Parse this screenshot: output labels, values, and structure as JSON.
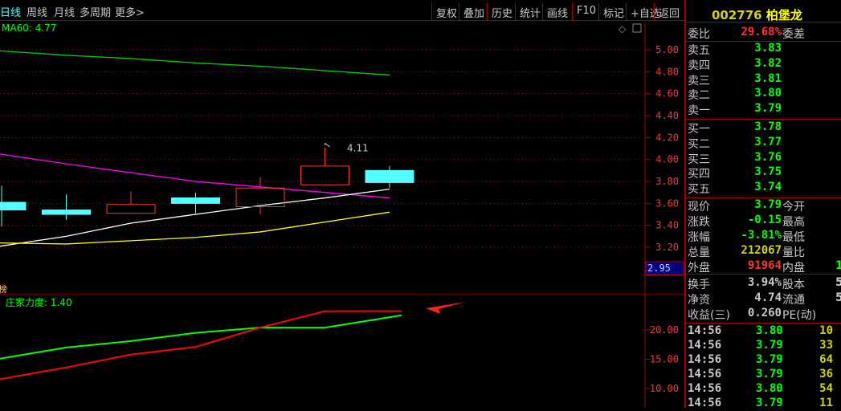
{
  "colors": {
    "up": "#ff3232",
    "down": "#54ffff",
    "grid": "#a00000",
    "axis": "#ff3232",
    "ma60": "#00d000",
    "ma_magenta": "#ff00ff",
    "ma_white": "#ffffff",
    "ma_yellow": "#ffff00",
    "ind_green": "#00ff00",
    "ind_red": "#ff0000",
    "arrow": "#ff2020"
  },
  "toolbar": {
    "tabs": [
      "日线",
      "周线",
      "月线",
      "多周期",
      "更多>"
    ],
    "active_tab": 0,
    "buttons": [
      "复权",
      "叠加",
      "历史",
      "统计",
      "画线",
      "F10",
      "标记",
      "+自选",
      "返回"
    ]
  },
  "main": {
    "ma_label": "MA60: 4.77",
    "high_marker": "4.11",
    "sub_icon_label": "榜",
    "indicator_label": "庄家力度: 1.40",
    "price_current_axis": "2.95"
  },
  "chart_data": [
    {
      "type": "candlestick",
      "yticks": [
        "5.00",
        "4.80",
        "4.60",
        "4.40",
        "4.20",
        "4.00",
        "3.80",
        "3.60",
        "3.40",
        "3.20"
      ],
      "ylim": [
        3.0,
        5.0
      ],
      "candles": [
        {
          "o": 3.61,
          "c": 3.54,
          "h": 3.76,
          "l": 3.39
        },
        {
          "o": 3.54,
          "c": 3.5,
          "h": 3.68,
          "l": 3.45
        },
        {
          "o": 3.51,
          "c": 3.59,
          "h": 3.71,
          "l": 3.51
        },
        {
          "o": 3.65,
          "c": 3.6,
          "h": 3.7,
          "l": 3.51
        },
        {
          "o": 3.57,
          "c": 3.74,
          "h": 3.84,
          "l": 3.5
        },
        {
          "o": 3.77,
          "c": 3.94,
          "h": 4.11,
          "l": 3.77
        },
        {
          "o": 3.9,
          "c": 3.79,
          "h": 3.94,
          "l": 3.74
        }
      ],
      "lines": [
        {
          "color": "ma60",
          "values": [
            4.99,
            4.95,
            4.92,
            4.88,
            4.85,
            4.81,
            4.77
          ]
        },
        {
          "color": "ma_magenta",
          "values": [
            4.05,
            3.96,
            3.88,
            3.8,
            3.75,
            3.7,
            3.65
          ]
        },
        {
          "color": "ma_white",
          "values": [
            3.21,
            3.3,
            3.42,
            3.5,
            3.58,
            3.65,
            3.73
          ]
        },
        {
          "color": "ma_yellow",
          "values": [
            3.24,
            3.23,
            3.26,
            3.29,
            3.34,
            3.43,
            3.52
          ]
        }
      ]
    },
    {
      "type": "line",
      "yticks": [
        "20.00",
        "15.00",
        "10.00"
      ],
      "ylim": [
        5,
        27
      ],
      "series": [
        {
          "color": "ind_green",
          "values": [
            15.1,
            17.0,
            18.1,
            19.5,
            20.4,
            20.4,
            22.5
          ]
        },
        {
          "color": "ind_red",
          "values": [
            11.6,
            13.6,
            15.8,
            17.1,
            20.4,
            23.2,
            23.2
          ]
        }
      ]
    }
  ],
  "panel": {
    "code": "002776",
    "name": "柏堡龙",
    "wei_bi": {
      "label": "委比",
      "value": "29.68%",
      "label2": "委差"
    },
    "sell": [
      {
        "label": "卖五",
        "price": "3.83"
      },
      {
        "label": "卖四",
        "price": "3.82"
      },
      {
        "label": "卖三",
        "price": "3.81"
      },
      {
        "label": "卖二",
        "price": "3.80"
      },
      {
        "label": "卖一",
        "price": "3.79"
      }
    ],
    "buy": [
      {
        "label": "买一",
        "price": "3.78"
      },
      {
        "label": "买二",
        "price": "3.77"
      },
      {
        "label": "买三",
        "price": "3.76"
      },
      {
        "label": "买四",
        "price": "3.75"
      },
      {
        "label": "买五",
        "price": "3.74"
      }
    ],
    "quote": [
      {
        "label": "现价",
        "value": "3.79",
        "color": "green",
        "label2": "今开",
        "value2": ""
      },
      {
        "label": "涨跌",
        "value": "-0.15",
        "color": "green",
        "label2": "最高",
        "value2": ""
      },
      {
        "label": "涨幅",
        "value": "-3.81%",
        "color": "green",
        "label2": "最低",
        "value2": ""
      },
      {
        "label": "总量",
        "value": "212067",
        "color": "yellow",
        "label2": "量比",
        "value2": ""
      },
      {
        "label": "外盘",
        "value": "91964",
        "color": "red",
        "label2": "内盘",
        "value2": "1"
      }
    ],
    "info": [
      {
        "label": "换手",
        "value": "3.94%",
        "label2": "股本",
        "value2": "5"
      },
      {
        "label": "净资",
        "value": "4.74",
        "label2": "流通",
        "value2": "5"
      },
      {
        "label": "收益(三)",
        "value": "0.260",
        "label2": "PE(动)",
        "value2": ""
      }
    ],
    "trades": [
      {
        "time": "14:56",
        "price": "3.80",
        "vol": "10",
        "dir": "up"
      },
      {
        "time": "14:56",
        "price": "3.79",
        "vol": "33",
        "dir": "down"
      },
      {
        "time": "14:56",
        "price": "3.79",
        "vol": "64",
        "dir": "down"
      },
      {
        "time": "14:56",
        "price": "3.79",
        "vol": "36",
        "dir": "up"
      },
      {
        "time": "14:56",
        "price": "3.80",
        "vol": "54",
        "dir": "up"
      },
      {
        "time": "14:56",
        "price": "3.79",
        "vol": "11",
        "dir": "down"
      }
    ]
  }
}
